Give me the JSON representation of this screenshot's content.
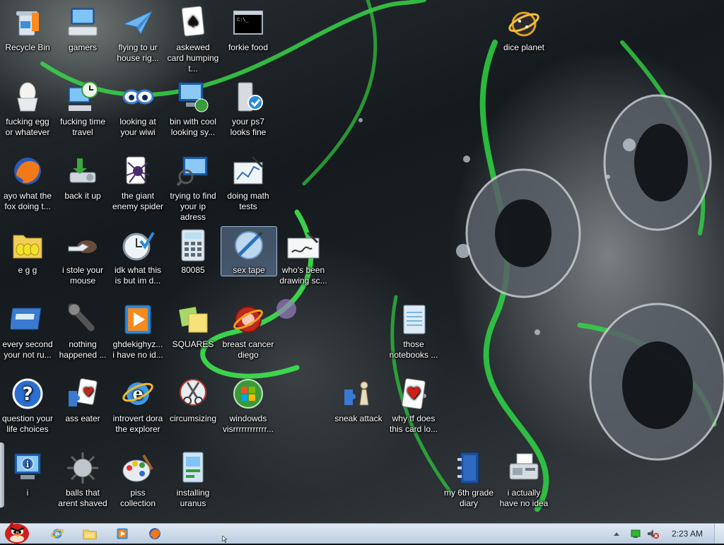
{
  "desktop": {
    "icons": [
      {
        "label": "Recycle Bin"
      },
      {
        "label": "gamers"
      },
      {
        "label": "flying to ur house rig..."
      },
      {
        "label": "askewed card humping t..."
      },
      {
        "label": "forkie food"
      },
      {
        "label": "dice planet"
      },
      {
        "label": "fucking egg or whatever"
      },
      {
        "label": "fucking time travel"
      },
      {
        "label": "looking at your wiwi"
      },
      {
        "label": "bin with cool looking sy..."
      },
      {
        "label": "your ps7 looks fine"
      },
      {
        "label": "ayo what the fox doing t..."
      },
      {
        "label": "back it up"
      },
      {
        "label": "the giant enemy spider"
      },
      {
        "label": "trying to find your ip adress"
      },
      {
        "label": "doing math tests"
      },
      {
        "label": "e g g"
      },
      {
        "label": "i stole your mouse"
      },
      {
        "label": "idk what this is but im d..."
      },
      {
        "label": "80085"
      },
      {
        "label": "sex tape"
      },
      {
        "label": "who's been drawing sc..."
      },
      {
        "label": "every second your not ru..."
      },
      {
        "label": "nothing happened ..."
      },
      {
        "label": "ghdekighyz... i have no id..."
      },
      {
        "label": "SQUARES"
      },
      {
        "label": "breast cancer diego"
      },
      {
        "label": "those notebooks ..."
      },
      {
        "label": "question your life choices"
      },
      {
        "label": "ass eater"
      },
      {
        "label": "introvert dora the explorer"
      },
      {
        "label": "circumsizing"
      },
      {
        "label": "windowds visrrrrrrrrrrrr..."
      },
      {
        "label": "sneak attack"
      },
      {
        "label": "why tf does this card lo..."
      },
      {
        "label": "i"
      },
      {
        "label": "balls that arent shaved"
      },
      {
        "label": "piss collection"
      },
      {
        "label": "installing uranus"
      },
      {
        "label": "my 6th grade diary"
      },
      {
        "label": "i actually have no idea"
      }
    ]
  },
  "taskbar": {
    "start_icon": "angry-bird-orb-icon",
    "pinned": [
      {
        "name": "internet-explorer-icon"
      },
      {
        "name": "folder-library-icon"
      },
      {
        "name": "media-player-icon"
      },
      {
        "name": "firefox-icon"
      }
    ],
    "tray": {
      "clock": "2:23 AM",
      "icons": [
        "show-hidden-chevron-icon",
        "network-icon",
        "volume-muted-icon"
      ]
    }
  }
}
